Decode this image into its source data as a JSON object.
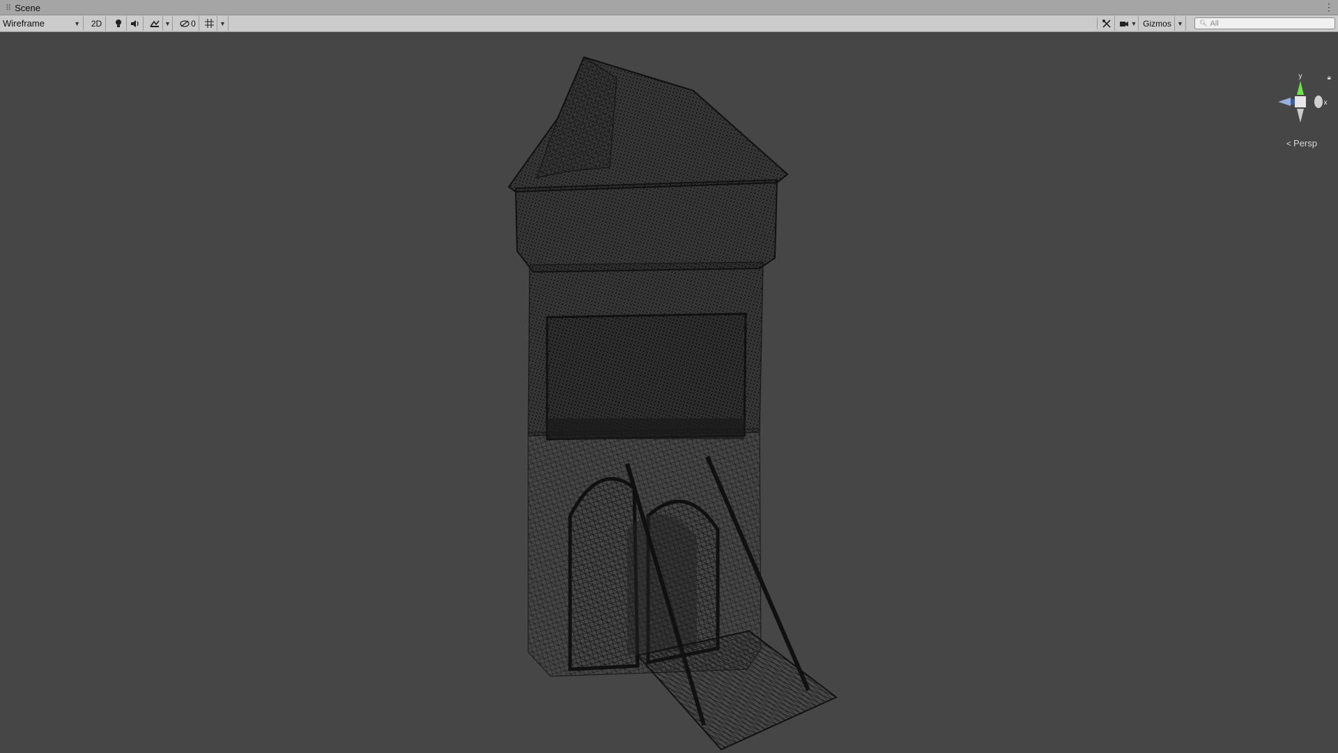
{
  "window": {
    "tab_title": "Scene",
    "tab_menu_icon": "kebab-menu-icon"
  },
  "toolbar": {
    "draw_mode": "Wireframe",
    "toggle_2d": "2D",
    "hidden_count": "0",
    "gizmos_label": "Gizmos",
    "search_placeholder": "All"
  },
  "scene_gizmo": {
    "axis_y": "y",
    "projection_label": "Persp"
  },
  "viewport": {
    "background": "#464646",
    "wire_color": "#151515",
    "object": "tower-wireframe"
  }
}
